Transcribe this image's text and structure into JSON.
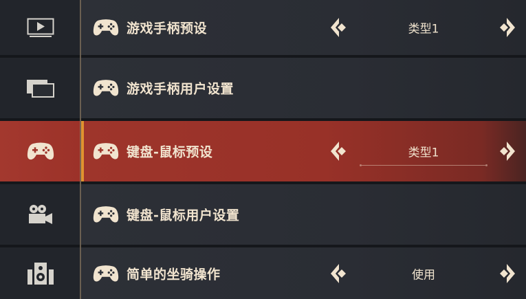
{
  "sidebar": {
    "items": [
      {
        "icon": "video-icon"
      },
      {
        "icon": "windows-icon"
      },
      {
        "icon": "gamepad-icon"
      },
      {
        "icon": "camera-icon"
      },
      {
        "icon": "speaker-icon"
      }
    ],
    "active_index": 2
  },
  "settings": [
    {
      "label": "游戏手柄预设",
      "value": "类型1",
      "icon": "gamepad-icon"
    },
    {
      "label": "游戏手柄用户设置",
      "icon": "gamepad-icon"
    },
    {
      "label": "键盘-鼠标预设",
      "value": "类型1",
      "icon": "gamepad-icon"
    },
    {
      "label": "键盘-鼠标用户设置",
      "icon": "gamepad-icon"
    },
    {
      "label": "简单的坐骑操作",
      "value": "使用",
      "icon": "gamepad-icon"
    }
  ],
  "colors": {
    "active_row": "#9e352b",
    "accent_bar": "#e0922f",
    "text": "#f1e4cf",
    "row_bg": "#2d3037"
  }
}
